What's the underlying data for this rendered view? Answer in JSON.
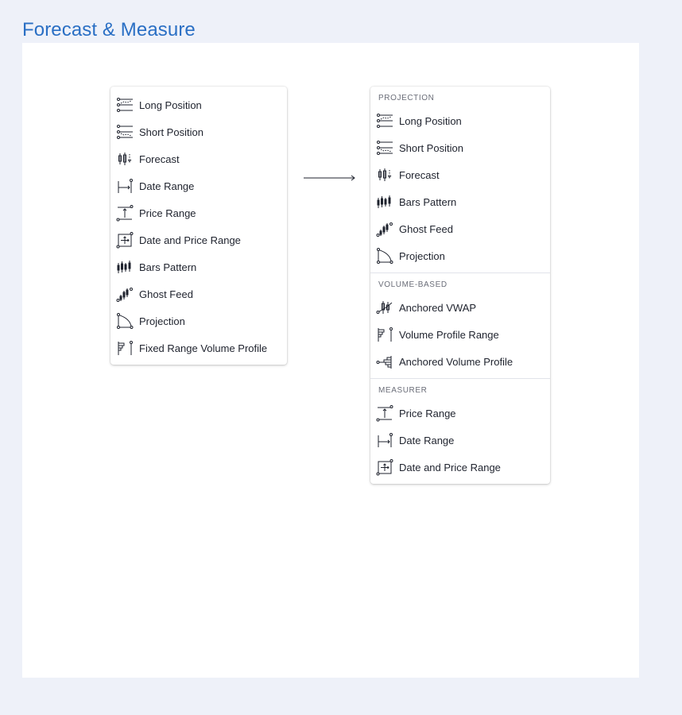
{
  "page": {
    "title": "Forecast & Measure"
  },
  "old_menu": {
    "items": [
      {
        "label": "Long Position",
        "icon": "long-position-icon"
      },
      {
        "label": "Short Position",
        "icon": "short-position-icon"
      },
      {
        "label": "Forecast",
        "icon": "forecast-icon"
      },
      {
        "label": "Date Range",
        "icon": "date-range-icon"
      },
      {
        "label": "Price Range",
        "icon": "price-range-icon"
      },
      {
        "label": "Date and Price Range",
        "icon": "date-price-range-icon"
      },
      {
        "label": "Bars Pattern",
        "icon": "bars-pattern-icon"
      },
      {
        "label": "Ghost Feed",
        "icon": "ghost-feed-icon"
      },
      {
        "label": "Projection",
        "icon": "projection-icon"
      },
      {
        "label": "Fixed Range Volume Profile",
        "icon": "fixed-range-volume-profile-icon"
      }
    ]
  },
  "new_menu": {
    "sections": [
      {
        "header": "PROJECTION",
        "items": [
          {
            "label": "Long Position",
            "icon": "long-position-icon"
          },
          {
            "label": "Short Position",
            "icon": "short-position-icon"
          },
          {
            "label": "Forecast",
            "icon": "forecast-icon"
          },
          {
            "label": "Bars Pattern",
            "icon": "bars-pattern-icon"
          },
          {
            "label": "Ghost Feed",
            "icon": "ghost-feed-icon"
          },
          {
            "label": "Projection",
            "icon": "projection-icon"
          }
        ]
      },
      {
        "header": "VOLUME-BASED",
        "items": [
          {
            "label": "Anchored VWAP",
            "icon": "anchored-vwap-icon"
          },
          {
            "label": "Volume Profile Range",
            "icon": "volume-profile-range-icon"
          },
          {
            "label": "Anchored Volume Profile",
            "icon": "anchored-volume-profile-icon"
          }
        ]
      },
      {
        "header": "MEASURER",
        "items": [
          {
            "label": "Price Range",
            "icon": "price-range-icon"
          },
          {
            "label": "Date Range",
            "icon": "date-range-icon"
          },
          {
            "label": "Date and Price Range",
            "icon": "date-price-range-icon"
          }
        ]
      }
    ]
  },
  "colors": {
    "title": "#2a6fc4",
    "background": "#eef1f9",
    "text": "#1e222d",
    "section_header": "#6a6d78"
  }
}
